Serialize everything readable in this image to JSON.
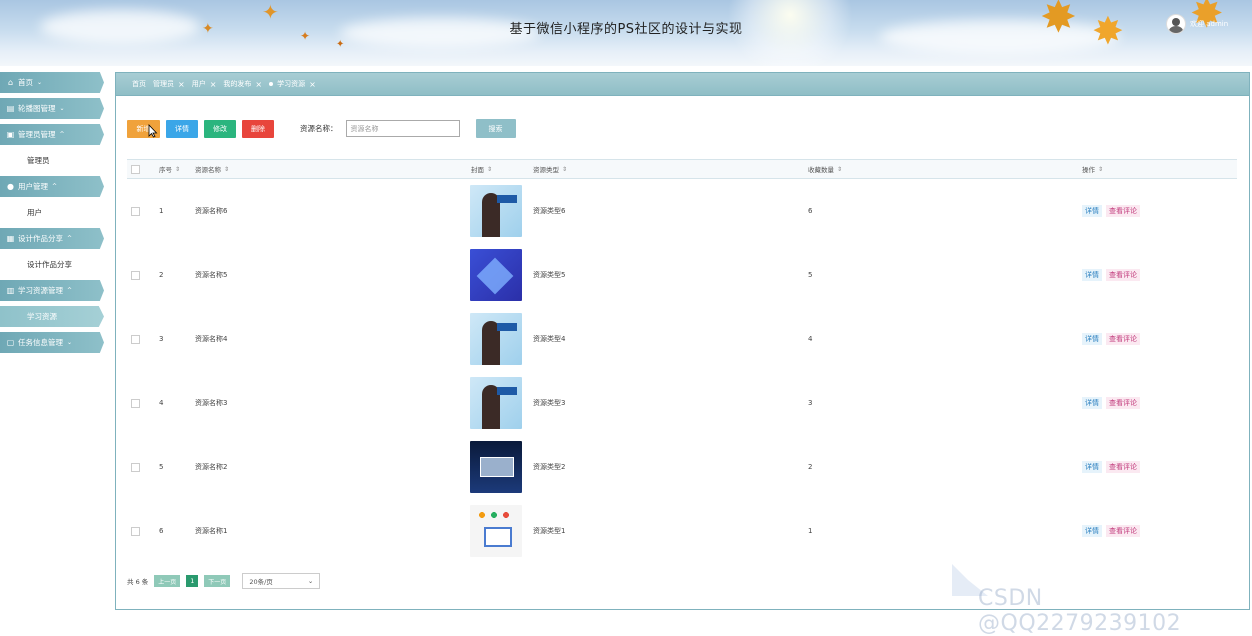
{
  "header": {
    "title": "基于微信小程序的PS社区的设计与实现",
    "user_label": "欢迎 admin"
  },
  "sidebar": {
    "items": [
      {
        "label": "首页",
        "icon": "home-icon",
        "chevron": "⌄"
      },
      {
        "label": "轮播图管理",
        "icon": "carousel-icon",
        "chevron": "⌄"
      },
      {
        "label": "管理员管理",
        "icon": "admin-icon",
        "chevron": "^",
        "sub": "管理员"
      },
      {
        "label": "用户管理",
        "icon": "user-icon",
        "chevron": "^",
        "sub": "用户"
      },
      {
        "label": "设计作品分享",
        "icon": "grid-icon",
        "chevron": "^",
        "sub": "设计作品分享"
      },
      {
        "label": "学习资源管理",
        "icon": "resource-icon",
        "chevron": "^",
        "sub": "学习资源"
      },
      {
        "label": "任务信息管理",
        "icon": "task-icon",
        "chevron": "⌄"
      }
    ]
  },
  "tabs": [
    {
      "label": "首页",
      "closable": false
    },
    {
      "label": "管理员",
      "closable": true
    },
    {
      "label": "用户",
      "closable": true
    },
    {
      "label": "我的发布",
      "closable": true
    },
    {
      "label": "学习资源",
      "closable": true,
      "active": true
    }
  ],
  "toolbar": {
    "add_label": "新增",
    "detail_label": "详情",
    "edit_label": "修改",
    "delete_label": "删除",
    "search_label": "资源名称：",
    "search_placeholder": "资源名称",
    "search_button": "搜索"
  },
  "table": {
    "columns": [
      "序号",
      "资源名称",
      "封面",
      "资源类型",
      "收藏数量",
      "操作"
    ],
    "rows": [
      {
        "index": "1",
        "name": "资源名称6",
        "type": "资源类型6",
        "favorites": "6",
        "cover": "a"
      },
      {
        "index": "2",
        "name": "资源名称5",
        "type": "资源类型5",
        "favorites": "5",
        "cover": "b"
      },
      {
        "index": "3",
        "name": "资源名称4",
        "type": "资源类型4",
        "favorites": "4",
        "cover": "a"
      },
      {
        "index": "4",
        "name": "资源名称3",
        "type": "资源类型3",
        "favorites": "3",
        "cover": "a"
      },
      {
        "index": "5",
        "name": "资源名称2",
        "type": "资源类型2",
        "favorites": "2",
        "cover": "c"
      },
      {
        "index": "6",
        "name": "资源名称1",
        "type": "资源类型1",
        "favorites": "1",
        "cover": "d"
      }
    ],
    "op_detail": "详情",
    "op_comment": "查看评论"
  },
  "pager": {
    "total": "共 6 条",
    "prev": "上一页",
    "current": "1",
    "next": "下一页",
    "page_size": "20条/页"
  },
  "watermark": "CSDN @QQ2279239102"
}
